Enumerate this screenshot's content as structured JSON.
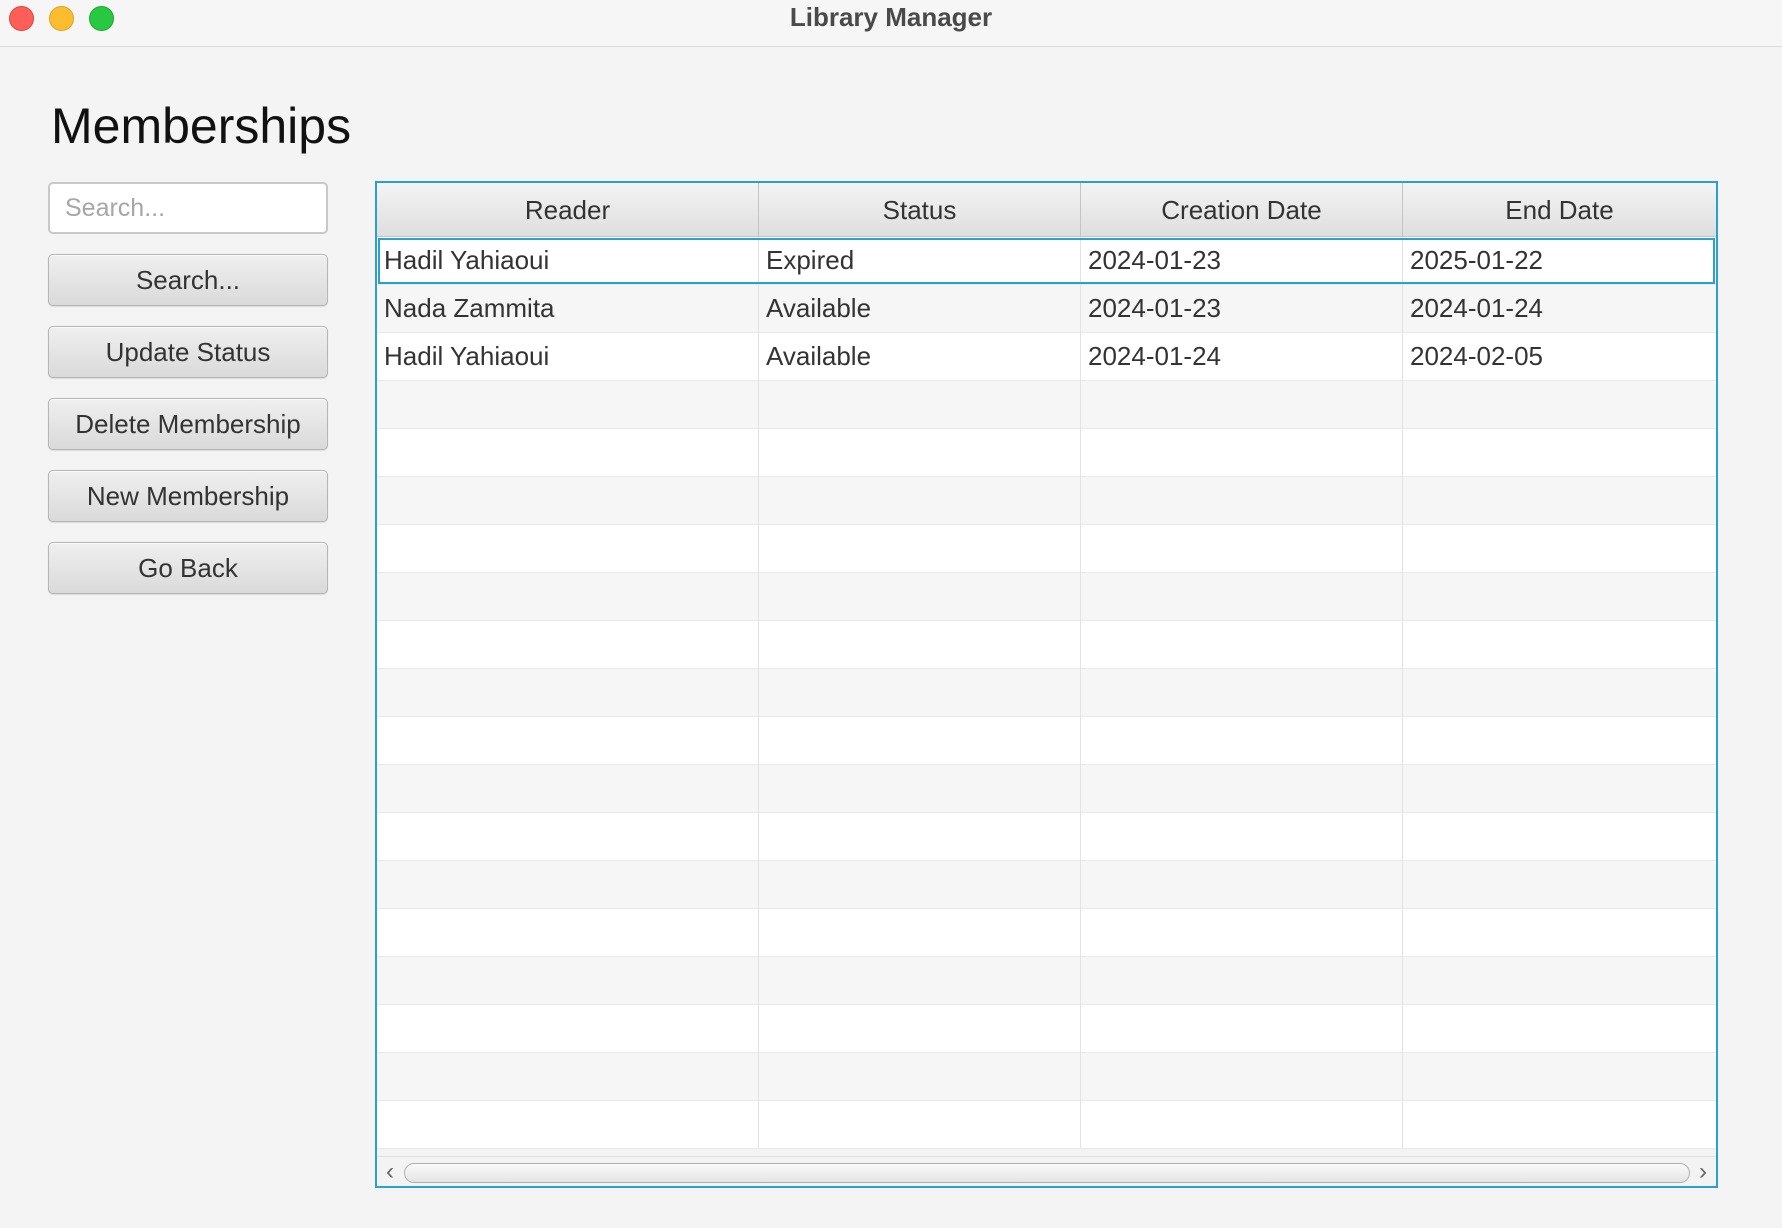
{
  "window": {
    "title": "Library Manager"
  },
  "page": {
    "title": "Memberships"
  },
  "search": {
    "placeholder": "Search...",
    "value": ""
  },
  "buttons": {
    "search": "Search...",
    "update_status": "Update Status",
    "delete_membership": "Delete Membership",
    "new_membership": "New Membership",
    "go_back": "Go Back"
  },
  "table": {
    "columns": [
      "Reader",
      "Status",
      "Creation Date",
      "End Date"
    ],
    "rows": [
      [
        "Hadil Yahiaoui",
        "Expired",
        "2024-01-23",
        "2025-01-22"
      ],
      [
        "Nada Zammita",
        "Available",
        "2024-01-23",
        "2024-01-24"
      ],
      [
        "Hadil Yahiaoui",
        "Available",
        "2024-01-24",
        "2024-02-05"
      ]
    ],
    "selected_row": 0
  },
  "colors": {
    "accent": "#2a9fd6",
    "close": "#ff5f57",
    "minimize": "#febc2e",
    "maximize": "#28c840"
  },
  "icons": {
    "scroll_left": "chevron-left-icon",
    "scroll_right": "chevron-right-icon"
  }
}
